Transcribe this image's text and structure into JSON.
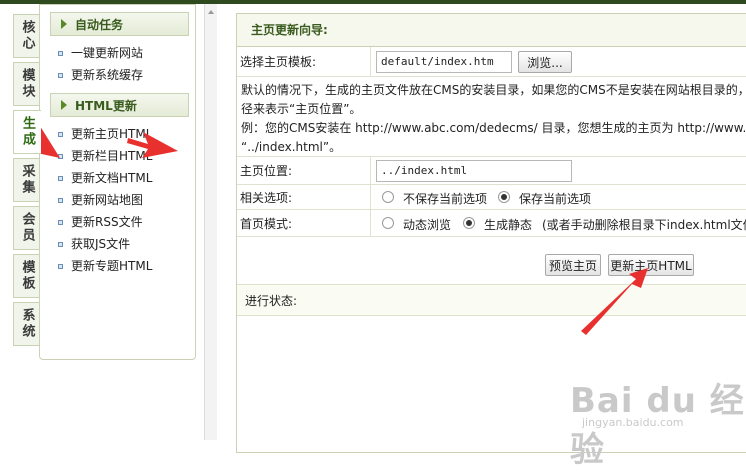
{
  "sidebar": {
    "tabs": [
      {
        "label": "核心",
        "active": false
      },
      {
        "label": "模块",
        "active": false
      },
      {
        "label": "生成",
        "active": true
      },
      {
        "label": "采集",
        "active": false
      },
      {
        "label": "会员",
        "active": false
      },
      {
        "label": "模板",
        "active": false
      },
      {
        "label": "系统",
        "active": false
      }
    ]
  },
  "menu": {
    "sections": [
      {
        "title": "自动任务",
        "items": [
          "一键更新网站",
          "更新系统缓存"
        ]
      },
      {
        "title": "HTML更新",
        "items": [
          "更新主页HTML",
          "更新栏目HTML",
          "更新文档HTML",
          "更新网站地图",
          "更新RSS文件",
          "获取JS文件",
          "更新专题HTML"
        ]
      }
    ]
  },
  "main": {
    "title": "主页更新向导:",
    "template_label": "选择主页模板:",
    "template_value": "default/index.htm",
    "browse_label": "浏览...",
    "desc_line1": "默认的情况下，生成的主页文件放在CMS的安装目录，如果您的CMS不是安装在网站根目录的，又想",
    "desc_line2": "径来表示“主页位置”。",
    "desc_line3": "例：您的CMS安装在 http://www.abc.com/dedecms/ 目录，您想生成的主页为 http://www.abc.c",
    "desc_line4": "“../index.html”。",
    "position_label": "主页位置:",
    "position_value": "../index.html",
    "options_label": "相关选项:",
    "option_no_save": "不保存当前选项",
    "option_save": "保存当前选项",
    "mode_label": "首页模式:",
    "mode_dynamic": "动态浏览",
    "mode_static": "生成静态",
    "mode_note": "(或者手动删除根目录下index.html文件",
    "preview_label": "预览主页",
    "update_label": "更新主页HTML",
    "status_label": "进行状态:"
  },
  "watermark": {
    "text": "Bai du 经验",
    "sub": "jingyan.baidu.com"
  },
  "colors": {
    "accent": "#3a5b1e",
    "arrow": "#e8312f",
    "border": "#c9d3b4"
  }
}
